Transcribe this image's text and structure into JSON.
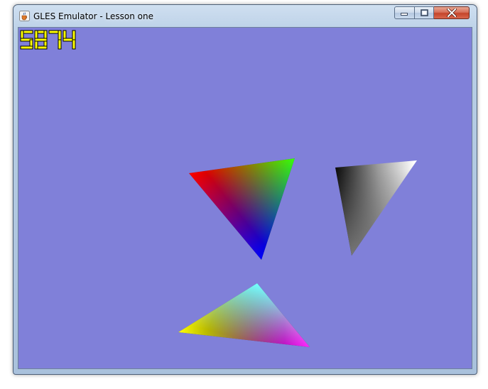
{
  "window": {
    "title": "GLES Emulator - Lesson one",
    "icon": "java-cup-icon"
  },
  "title_controls": {
    "minimize_icon": "minimize-icon",
    "maximize_icon": "maximize-icon",
    "close_icon": "close-icon",
    "close_color": "#c4452b"
  },
  "viewport": {
    "background_color": "#8080d9",
    "fps_counter": "5874",
    "fps_color": "#ffff00",
    "triangles": [
      {
        "name": "rgb-gradient-triangle",
        "vertex_colors": [
          "#ff0000",
          "#00ff00",
          "#0000ff"
        ]
      },
      {
        "name": "grayscale-gradient-triangle",
        "vertex_colors": [
          "#000000",
          "#ffffff",
          "#808080"
        ]
      },
      {
        "name": "cmy-gradient-triangle",
        "vertex_colors": [
          "#00ffff",
          "#ffff00",
          "#ff00ff"
        ]
      }
    ]
  }
}
